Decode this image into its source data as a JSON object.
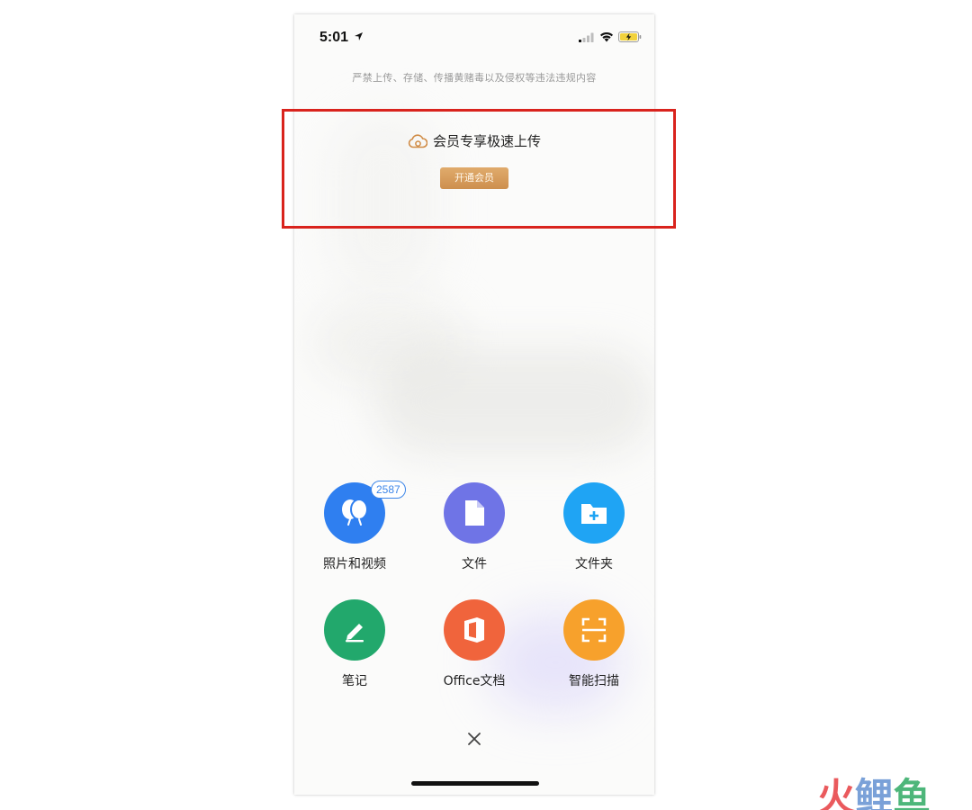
{
  "status_bar": {
    "time": "5:01"
  },
  "notice": "严禁上传、存储、传播黄赌毒以及侵权等违法违规内容",
  "member": {
    "title": "会员专享极速上传",
    "button_label": "开通会员",
    "icon": "cloud-icon"
  },
  "upload_options": [
    {
      "label": "照片和视频",
      "icon": "balloon-icon",
      "color": "#2f7ff0",
      "badge": "2587"
    },
    {
      "label": "文件",
      "icon": "file-icon",
      "color": "#6f74e6"
    },
    {
      "label": "文件夹",
      "icon": "folder-add-icon",
      "color": "#1fa4f4"
    },
    {
      "label": "笔记",
      "icon": "pencil-icon",
      "color": "#22a86c"
    },
    {
      "label": "Office文档",
      "icon": "office-icon",
      "color": "#f0643c"
    },
    {
      "label": "智能扫描",
      "icon": "scan-icon",
      "color": "#f7a12c"
    }
  ],
  "close_icon": "close-icon",
  "watermark": {
    "c1": "火",
    "c2": "鲤",
    "c3": "鱼"
  }
}
